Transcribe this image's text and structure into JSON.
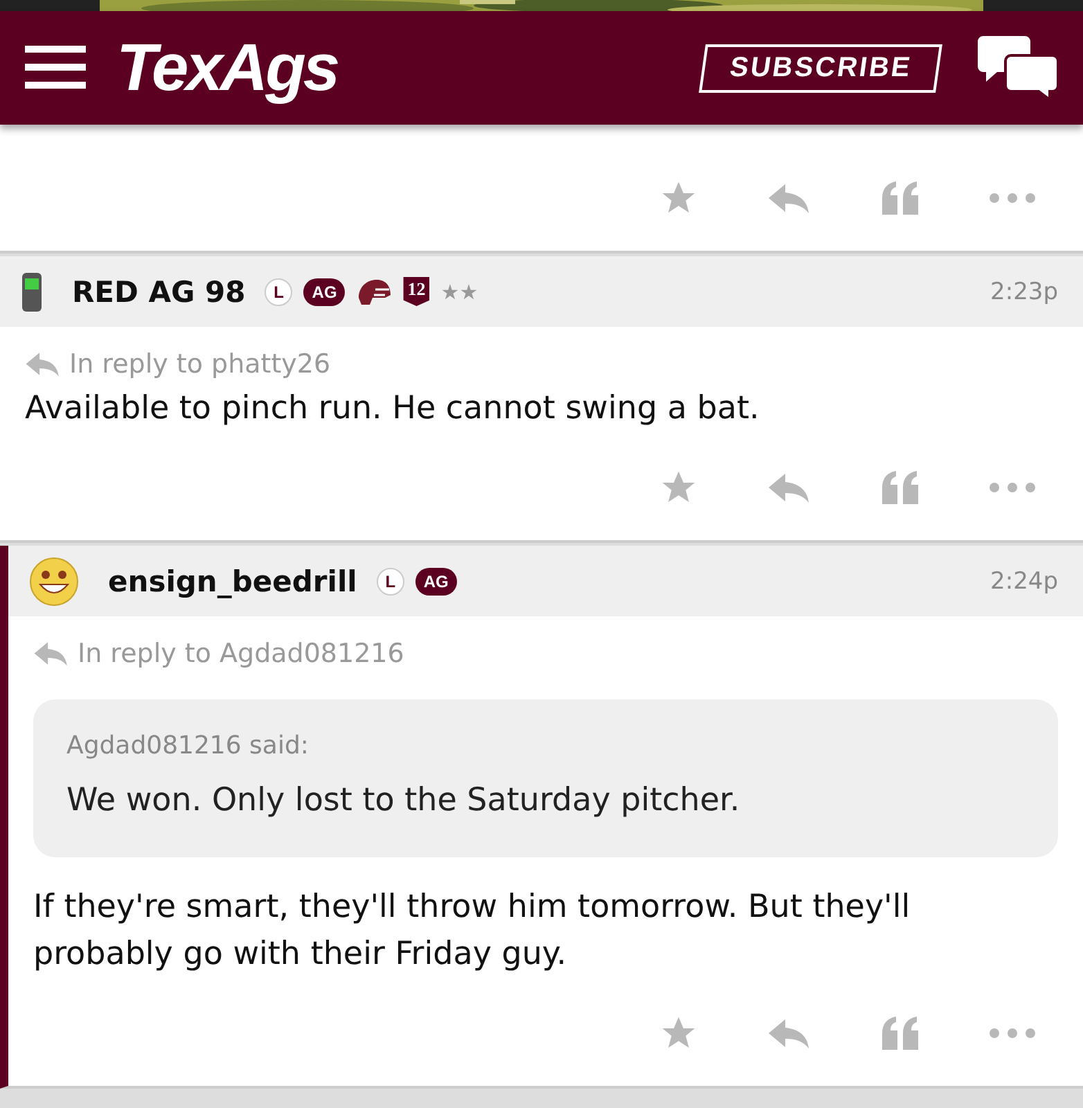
{
  "header": {
    "logo": "TexAgs",
    "subscribe": "SUBSCRIBE"
  },
  "posts": [
    {
      "kind": "tail"
    },
    {
      "kind": "full",
      "avatar": {
        "kind": "phone"
      },
      "username": "RED AG 98",
      "badges": [
        {
          "kind": "circle",
          "text": "L"
        },
        {
          "kind": "pill",
          "text": "AG"
        },
        {
          "kind": "helmet"
        },
        {
          "kind": "shield",
          "text": "12"
        },
        {
          "kind": "stars",
          "text": "★★"
        }
      ],
      "time": "2:23p",
      "reply_to": "In reply to phatty26",
      "body": "Available to pinch run. He cannot swing a bat.",
      "highlighted": false
    },
    {
      "kind": "full",
      "avatar": {
        "kind": "smiley"
      },
      "username": "ensign_beedrill",
      "badges": [
        {
          "kind": "circle",
          "text": "L"
        },
        {
          "kind": "pill",
          "text": "AG"
        }
      ],
      "time": "2:24p",
      "reply_to": "In reply to Agdad081216",
      "quote": {
        "author": "Agdad081216 said:",
        "text": "We won. Only lost to the Saturday pitcher."
      },
      "body": "If they're smart, they'll throw him tomorrow. But they'll probably go with their Friday guy.",
      "highlighted": true
    }
  ]
}
